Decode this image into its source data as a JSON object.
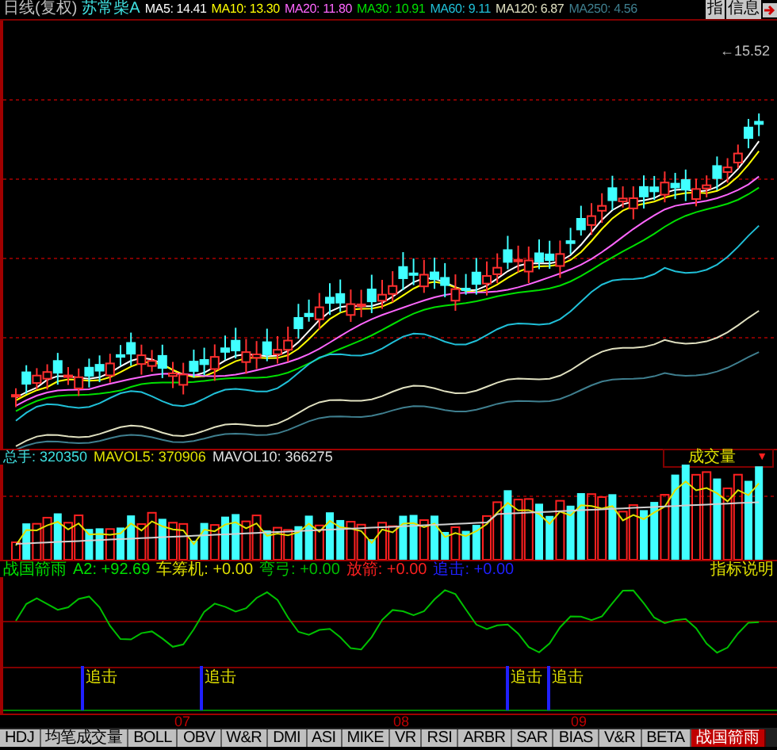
{
  "header": {
    "period": "日线(复权)",
    "stock": "苏常柴A",
    "ma": [
      {
        "label": "MA5: 14.41",
        "color": "#ffffff"
      },
      {
        "label": "MA10: 13.30",
        "color": "#ffff00"
      },
      {
        "label": "MA20: 11.80",
        "color": "#ff66ff"
      },
      {
        "label": "MA30: 10.91",
        "color": "#00e000"
      },
      {
        "label": "MA60: 9.11",
        "color": "#20c0d8"
      },
      {
        "label": "MA120: 6.87",
        "color": "#e0e0c0"
      },
      {
        "label": "MA250: 4.56",
        "color": "#3f7f8f"
      }
    ]
  },
  "toolbar": [
    {
      "label": "指"
    },
    {
      "label": "信息"
    }
  ],
  "price_chart": {
    "arrow": "←",
    "high_label": "15.52"
  },
  "volume": {
    "items": [
      {
        "label": "总手: 320350",
        "color": "#40e0e0"
      },
      {
        "label": "MAVOL5: 370906",
        "color": "#e0e000"
      },
      {
        "label": "MAVOL10: 366275",
        "color": "#e0e0e0"
      }
    ],
    "selector": "成交量",
    "arrow": "▼"
  },
  "indicator": {
    "name": "战国箭雨",
    "values": [
      {
        "label": "A2: +92.69",
        "color": "#00e000"
      },
      {
        "label": "车筹机: +0.00",
        "color": "#e0e000"
      },
      {
        "label": "弯弓: +0.00",
        "color": "#00c000"
      },
      {
        "label": "放箭: +0.00",
        "color": "#ff2020"
      },
      {
        "label": "追击: +0.00",
        "color": "#2020ff"
      }
    ],
    "help": "指标说明",
    "signals": [
      "追击",
      "追击",
      "追击",
      "追击"
    ]
  },
  "x_axis": [
    "07",
    "08",
    "09"
  ],
  "tabs": [
    {
      "label": "HDJ",
      "selected": false
    },
    {
      "label": "均笔成交量",
      "selected": false
    },
    {
      "label": "BOLL",
      "selected": false
    },
    {
      "label": "OBV",
      "selected": false
    },
    {
      "label": "W&R",
      "selected": false
    },
    {
      "label": "DMI",
      "selected": false
    },
    {
      "label": "ASI",
      "selected": false
    },
    {
      "label": "MIKE",
      "selected": false
    },
    {
      "label": "VR",
      "selected": false
    },
    {
      "label": "RSI",
      "selected": false
    },
    {
      "label": "ARBR",
      "selected": false
    },
    {
      "label": "SAR",
      "selected": false
    },
    {
      "label": "BIAS",
      "selected": false
    },
    {
      "label": "V&R",
      "selected": false
    },
    {
      "label": "BETA",
      "selected": false
    },
    {
      "label": "战国箭雨",
      "selected": true
    }
  ]
}
